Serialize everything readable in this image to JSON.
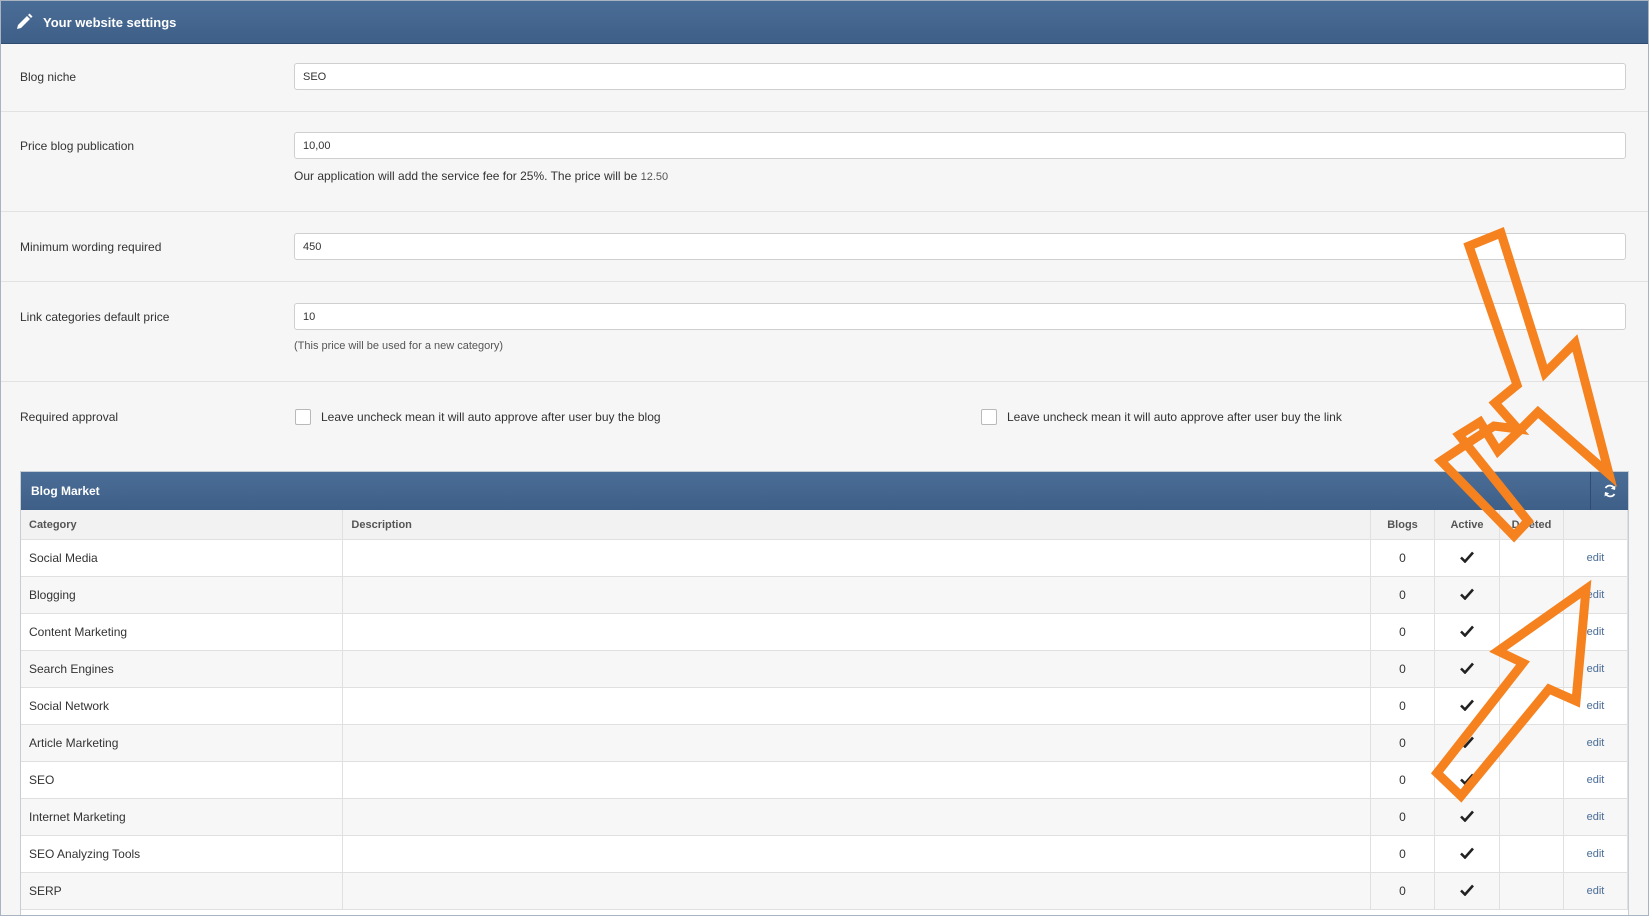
{
  "header": {
    "title": "Your website settings",
    "icon": "pencil-icon"
  },
  "fields": {
    "blog_niche": {
      "label": "Blog niche",
      "value": "SEO"
    },
    "price_blog": {
      "label": "Price blog publication",
      "value": "10,00",
      "help": "Our application will add the service fee for 25%. The price will be",
      "help_price": "12.50"
    },
    "min_wording": {
      "label": "Minimum wording required",
      "value": "450"
    },
    "link_categories": {
      "label": "Link categories default price",
      "value": "10",
      "help": "(This price will be used for a new category)"
    },
    "required_approval": {
      "label": "Required approval",
      "blog_option": "Leave uncheck mean it will auto approve after user buy the blog",
      "link_option": "Leave uncheck mean it will auto approve after user buy the link"
    }
  },
  "market": {
    "title": "Blog Market",
    "refresh_icon": "refresh-icon",
    "columns": [
      "Category",
      "Description",
      "Blogs",
      "Active",
      "Deleted",
      ""
    ],
    "rows": [
      {
        "category": "Social Media",
        "description": "",
        "blogs": "0",
        "active": true,
        "deleted": "",
        "action": "edit"
      },
      {
        "category": "Blogging",
        "description": "",
        "blogs": "0",
        "active": true,
        "deleted": "",
        "action": "edit"
      },
      {
        "category": "Content Marketing",
        "description": "",
        "blogs": "0",
        "active": true,
        "deleted": "",
        "action": "edit"
      },
      {
        "category": "Search Engines",
        "description": "",
        "blogs": "0",
        "active": true,
        "deleted": "",
        "action": "edit"
      },
      {
        "category": "Social Network",
        "description": "",
        "blogs": "0",
        "active": true,
        "deleted": "",
        "action": "edit"
      },
      {
        "category": "Article Marketing",
        "description": "",
        "blogs": "0",
        "active": true,
        "deleted": "",
        "action": "edit"
      },
      {
        "category": "SEO",
        "description": "",
        "blogs": "0",
        "active": true,
        "deleted": "",
        "action": "edit"
      },
      {
        "category": "Internet Marketing",
        "description": "",
        "blogs": "0",
        "active": true,
        "deleted": "",
        "action": "edit"
      },
      {
        "category": "SEO Analyzing Tools",
        "description": "",
        "blogs": "0",
        "active": true,
        "deleted": "",
        "action": "edit"
      },
      {
        "category": "SERP",
        "description": "",
        "blogs": "0",
        "active": true,
        "deleted": "",
        "action": "edit"
      }
    ]
  },
  "annotation_color": "#f5821f"
}
